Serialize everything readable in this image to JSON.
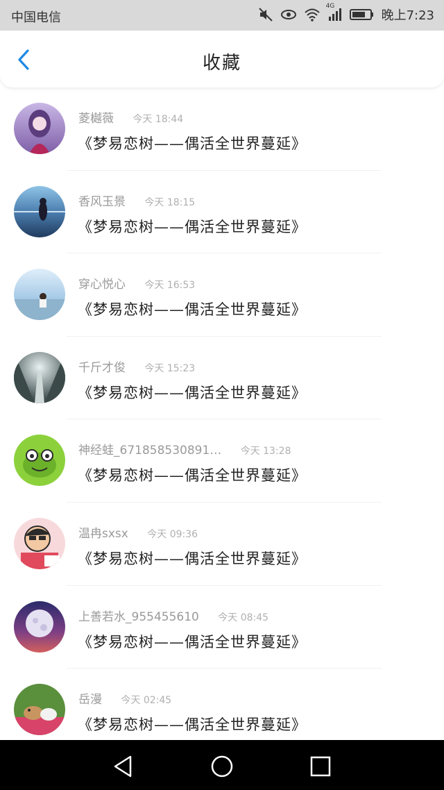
{
  "status_bar": {
    "carrier": "中国电信",
    "network": "4G",
    "time": "晚上7:23",
    "icons": [
      "mute-icon",
      "eye-icon",
      "wifi-icon",
      "signal-icon",
      "battery-icon"
    ]
  },
  "header": {
    "title": "收藏",
    "back_icon": "chevron-left-icon",
    "accent_color": "#1e88e5"
  },
  "items": [
    {
      "name": "菱樾薇",
      "time": "今天 18:44",
      "content": "《梦易恋树——偶活全世界蔓延》",
      "avatar": "anime-girl"
    },
    {
      "name": "香风玉景",
      "time": "今天 18:15",
      "content": "《梦易恋树——偶活全世界蔓延》",
      "avatar": "girl-lake"
    },
    {
      "name": "穿心悦心",
      "time": "今天 16:53",
      "content": "《梦易恋树——偶活全世界蔓延》",
      "avatar": "beach-person"
    },
    {
      "name": "千斤才俊",
      "time": "今天 15:23",
      "content": "《梦易恋树——偶活全世界蔓延》",
      "avatar": "forest-path"
    },
    {
      "name": "神经蛙_671858530891…",
      "time": "今天 13:28",
      "content": "《梦易恋树——偶活全世界蔓延》",
      "avatar": "green-frog"
    },
    {
      "name": "温冉sxsx",
      "time": "今天 09:36",
      "content": "《梦易恋树——偶活全世界蔓延》",
      "avatar": "cartoon-boy"
    },
    {
      "name": "上善若水_955455610",
      "time": "今天 08:45",
      "content": "《梦易恋树——偶活全世界蔓延》",
      "avatar": "moon-night"
    },
    {
      "name": "岳漫",
      "time": "今天 02:45",
      "content": "《梦易恋树——偶活全世界蔓延》",
      "avatar": "rabbits"
    }
  ],
  "nav_bar": {
    "buttons": [
      "back-triangle-icon",
      "home-circle-icon",
      "recents-square-icon"
    ]
  }
}
